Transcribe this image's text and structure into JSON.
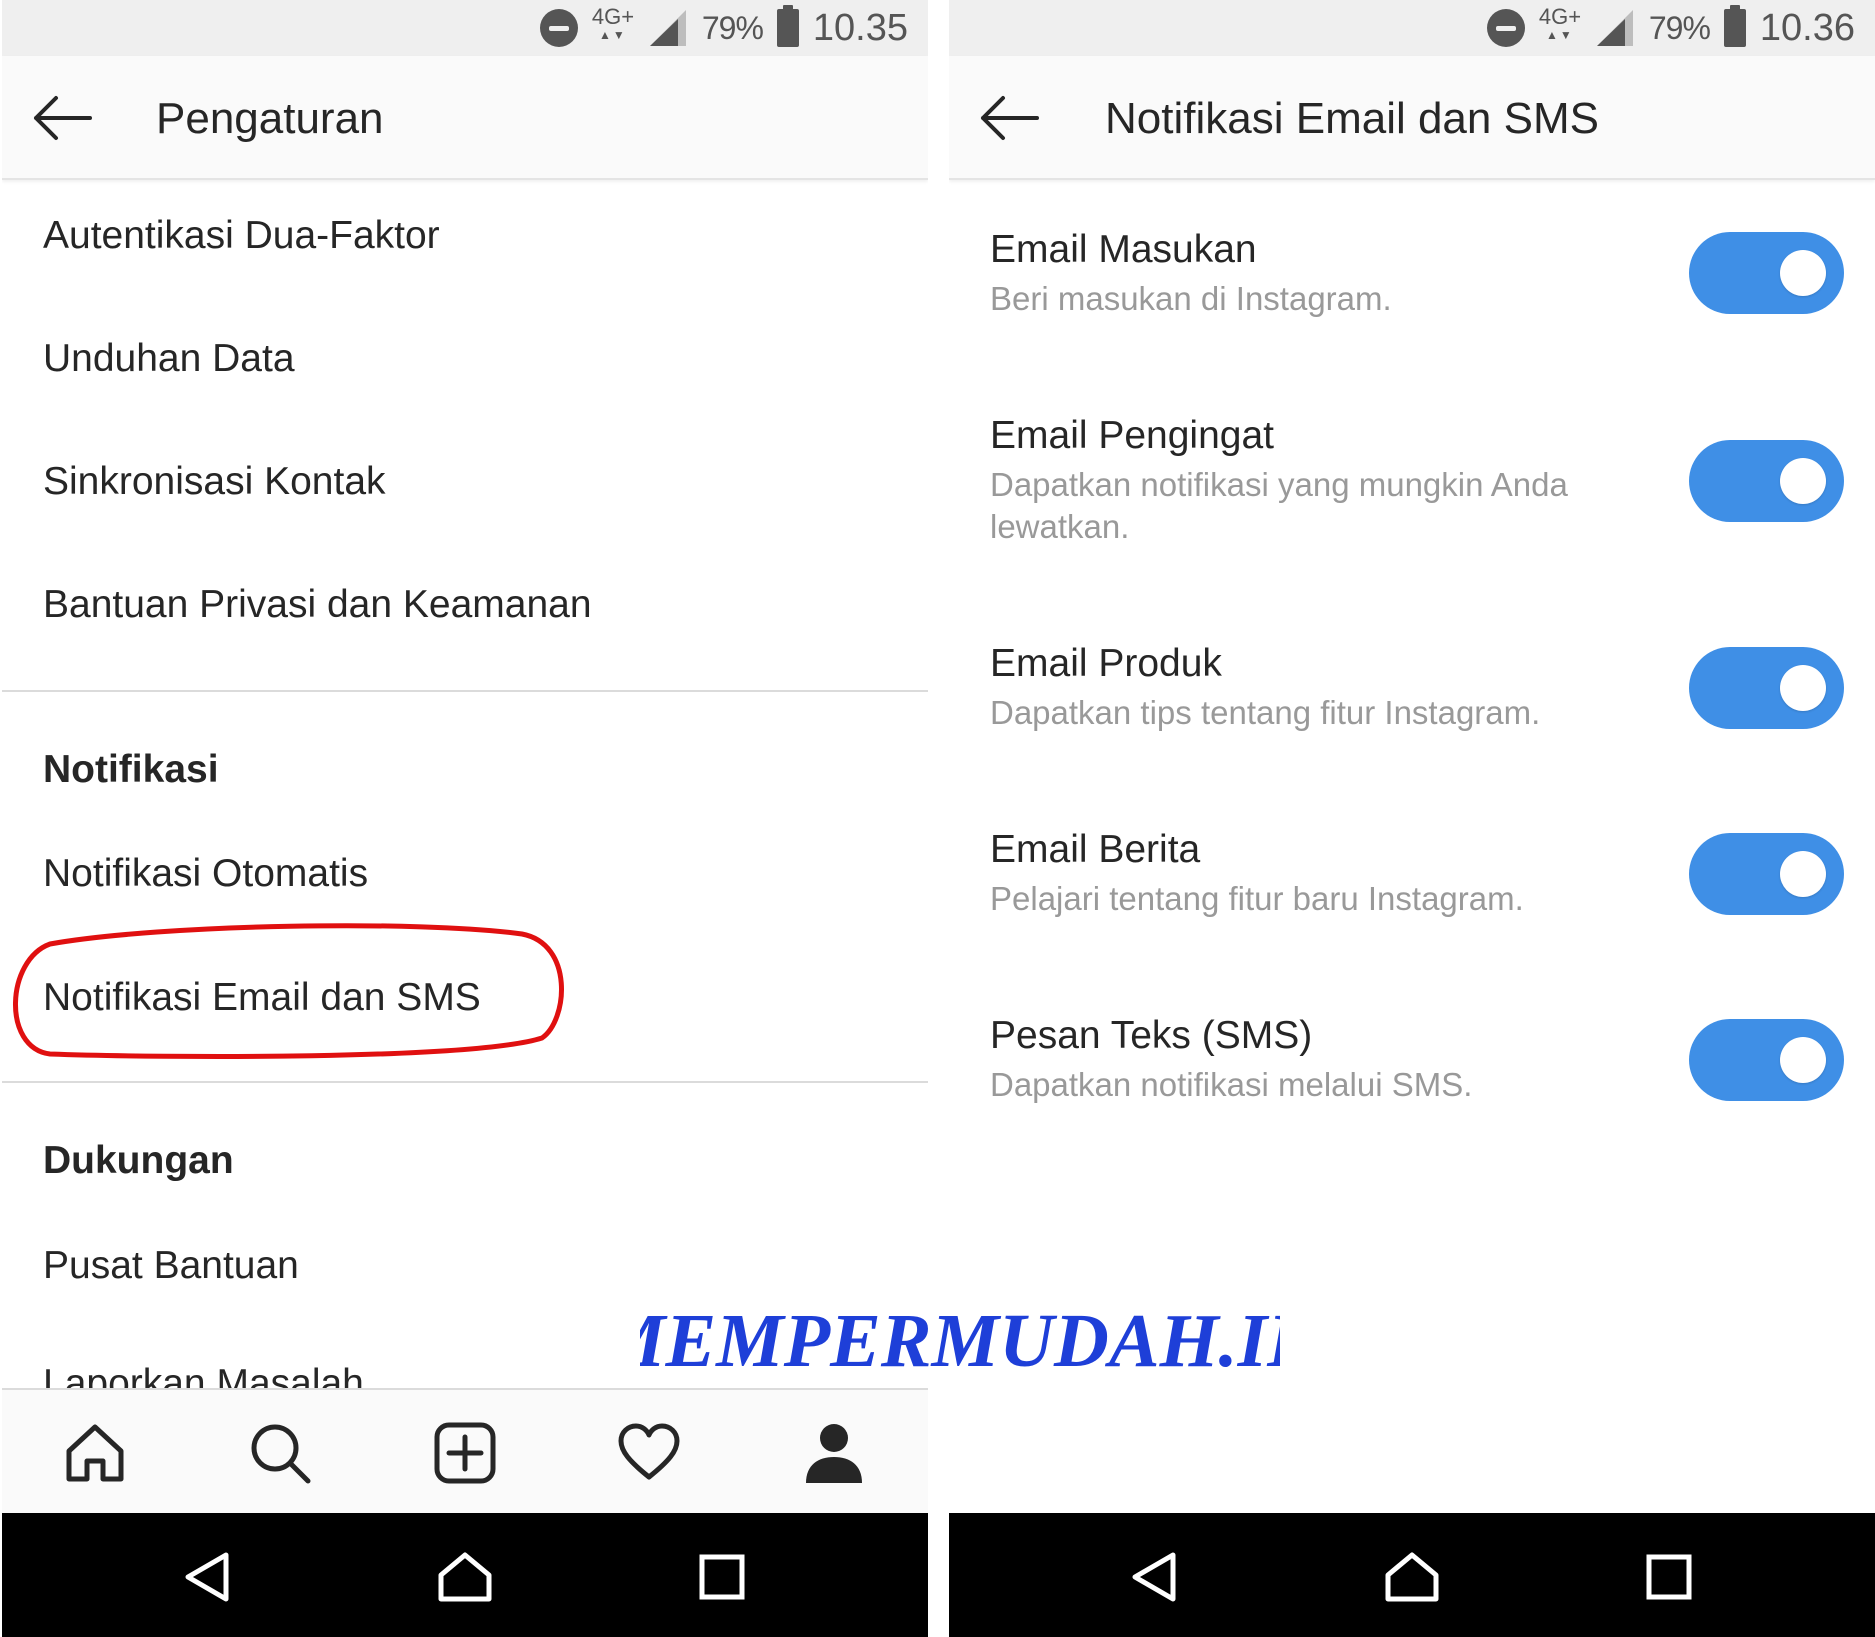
{
  "left_screen": {
    "status_bar": {
      "network": "4G+",
      "battery_percent": "79%",
      "time": "10.35"
    },
    "header": {
      "title": "Pengaturan"
    },
    "items": [
      {
        "label": "Autentikasi Dua-Faktor"
      },
      {
        "label": "Unduhan Data"
      },
      {
        "label": "Sinkronisasi Kontak"
      },
      {
        "label": "Bantuan Privasi dan Keamanan"
      }
    ],
    "notifications_section": {
      "heading": "Notifikasi",
      "items": [
        {
          "label": "Notifikasi Otomatis"
        },
        {
          "label": "Notifikasi Email dan SMS"
        }
      ]
    },
    "support_section": {
      "heading": "Dukungan",
      "items": [
        {
          "label": "Pusat Bantuan"
        },
        {
          "label": "Laporkan Masalah"
        }
      ]
    },
    "highlight_color": "#e01010"
  },
  "right_screen": {
    "status_bar": {
      "network": "4G+",
      "battery_percent": "79%",
      "time": "10.36"
    },
    "header": {
      "title": "Notifikasi Email dan SMS"
    },
    "toggles": [
      {
        "title": "Email Masukan",
        "subtitle": "Beri masukan di Instagram.",
        "on": true
      },
      {
        "title": "Email Pengingat",
        "subtitle": "Dapatkan notifikasi yang mungkin Anda lewatkan.",
        "on": true
      },
      {
        "title": "Email Produk",
        "subtitle": "Dapatkan tips tentang fitur Instagram.",
        "on": true
      },
      {
        "title": "Email Berita",
        "subtitle": "Pelajari tentang fitur baru Instagram.",
        "on": true
      },
      {
        "title": "Pesan Teks (SMS)",
        "subtitle": "Dapatkan notifikasi melalui SMS.",
        "on": true
      }
    ],
    "toggle_color": "#3f8fe6"
  },
  "watermark": {
    "text": "MEMPERMUDAH.ID",
    "fill_color": "#1e3fd8",
    "outline_color": "#ffffff"
  }
}
